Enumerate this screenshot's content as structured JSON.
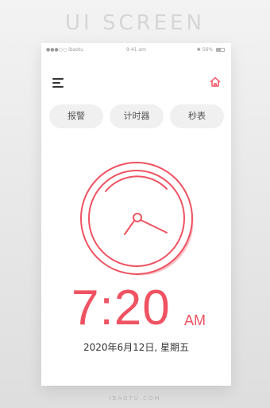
{
  "banner": {
    "title": "UI SCREEN"
  },
  "status_bar": {
    "carrier": "●●●○○ ibaotu",
    "time": "9:41 am",
    "battery": "56%",
    "bluetooth_icon": "bluetooth-icon",
    "wifi_icon": "wifi-icon"
  },
  "nav": {
    "menu_icon": "menu-icon",
    "home_icon": "home-icon"
  },
  "tabs": [
    {
      "label": "报警"
    },
    {
      "label": "计时器"
    },
    {
      "label": "秒表"
    }
  ],
  "clock": {
    "icon": "clock-icon",
    "displayed_time": "7:20",
    "period": "AM",
    "date": "2020年6月12日, 星期五"
  },
  "footer": {
    "watermark": "IBAOTU.COM"
  },
  "colors": {
    "accent": "#ef5362",
    "accent_soft": "#f6c3c9",
    "tab_bg": "#f0f0f0",
    "card_bg": "#ffffff",
    "page_bg": "#e9e9e9"
  }
}
